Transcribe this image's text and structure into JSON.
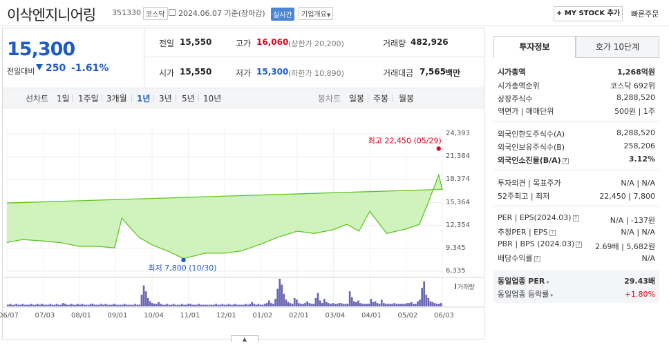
{
  "header": {
    "company": "이삭엔지니어링",
    "code": "351330",
    "market": "코스닥",
    "date_text": "2024.06.07 기준(장마감)",
    "realtime": "실시간",
    "company_info": "기업개요",
    "my_stock": "+ MY STOCK 추가",
    "quick_order": "빠른주문"
  },
  "quote": {
    "price": "15,300",
    "change_label": "전일대비",
    "change": "250",
    "change_pct": "-1.61%",
    "prev_close_label": "전일",
    "prev_close": "15,550",
    "high_label": "고가",
    "high": "16,060",
    "upper_limit": "(상한가 20,200)",
    "volume_label": "거래량",
    "volume": "482,926",
    "open_label": "시가",
    "open": "15,550",
    "low_label": "저가",
    "low": "15,300",
    "lower_limit": "(하한가 10,890)",
    "amount_label": "거래대금",
    "amount": "7,565",
    "amount_unit": "백만"
  },
  "period": {
    "line_label": "선차트",
    "tabs": [
      "1일",
      "1주일",
      "3개월",
      "1년",
      "3년",
      "5년",
      "10년"
    ],
    "selected": "1년",
    "candle_label": "봉차트",
    "candle_tabs": [
      "일봉",
      "주봉",
      "월봉"
    ]
  },
  "chart_data": {
    "type": "area",
    "title": "",
    "xlabel": "",
    "ylabel": "",
    "x_ticks": [
      "06/07",
      "07/03",
      "08/01",
      "09/01",
      "10/04",
      "11/01",
      "12/01",
      "01/02",
      "02/01",
      "03/04",
      "04/01",
      "05/02",
      "06/03"
    ],
    "y_ticks": [
      6335,
      9345,
      12354,
      15364,
      18374,
      21384,
      24393
    ],
    "ylim": [
      6335,
      24393
    ],
    "grid": true,
    "series": [
      {
        "dates": [
          "06/07",
          "06/20",
          "07/03",
          "07/17",
          "08/01",
          "08/16",
          "08/30",
          "09/06",
          "09/20",
          "10/04",
          "10/18",
          "10/30",
          "11/15",
          "12/01",
          "12/15",
          "01/02",
          "01/16",
          "02/01",
          "02/15",
          "03/04",
          "03/15",
          "03/25",
          "04/01",
          "04/15",
          "05/02",
          "05/13",
          "05/20",
          "05/29",
          "06/03",
          "06/07"
        ],
        "values": [
          10100,
          10500,
          10300,
          10100,
          9600,
          9600,
          9400,
          13300,
          10800,
          9800,
          8900,
          8000,
          8700,
          8700,
          9000,
          9900,
          10800,
          11600,
          11300,
          11800,
          12500,
          11600,
          14200,
          11300,
          11900,
          12500,
          15200,
          19000,
          17100,
          15300
        ]
      }
    ],
    "annotations": [
      {
        "label": "최고 22,450 (05/29)",
        "date": "05/29",
        "value": 22450
      },
      {
        "label": "최저 7,800 (10/30)",
        "date": "10/30",
        "value": 7800
      }
    ],
    "volume_label": "거래량",
    "volume": [
      2,
      3,
      2,
      2,
      3,
      2,
      2,
      3,
      2,
      2,
      2,
      3,
      2,
      2,
      3,
      2,
      3,
      2,
      2,
      2,
      3,
      2,
      2,
      3,
      2,
      2,
      4,
      3,
      2,
      2,
      3,
      2,
      2,
      3,
      2,
      3,
      2,
      2,
      2,
      3,
      3,
      2,
      2,
      2,
      3,
      2,
      3,
      2,
      2,
      2,
      3,
      2,
      2,
      2,
      2,
      3,
      2,
      2,
      2,
      2,
      3,
      2,
      2,
      14,
      25,
      18,
      10,
      6,
      4,
      3,
      3,
      5,
      3,
      2,
      2,
      3,
      2,
      2,
      3,
      2,
      2,
      2,
      3,
      2,
      2,
      3,
      3,
      2,
      2,
      2,
      3,
      2,
      2,
      2,
      2,
      2,
      2,
      2,
      3,
      2,
      2,
      3,
      2,
      2,
      3,
      2,
      2,
      3,
      2,
      2,
      2,
      2,
      3,
      2,
      3,
      5,
      3,
      2,
      3,
      2,
      2,
      3,
      4,
      7,
      4,
      3,
      9,
      21,
      33,
      26,
      15,
      8,
      5,
      4,
      3,
      10,
      8,
      4,
      3,
      3,
      4,
      6,
      4,
      3,
      3,
      10,
      16,
      7,
      4,
      9,
      5,
      4,
      3,
      4,
      3,
      3,
      4,
      4,
      3,
      3,
      3,
      18,
      11,
      6,
      5,
      7,
      4,
      3,
      3,
      3,
      3,
      9,
      5,
      6,
      4,
      3,
      8,
      4,
      3,
      3,
      3,
      3,
      4,
      3,
      3,
      3,
      3,
      3,
      4,
      4,
      5,
      3,
      3,
      6,
      8,
      22,
      30,
      14,
      10,
      6,
      5,
      4,
      3,
      3,
      4
    ]
  },
  "tabs": {
    "invest": "투자정보",
    "orderbook": "호가 10단계"
  },
  "invest_info": {
    "market_cap_label": "시가총액",
    "market_cap": "1,268억원",
    "rank_label": "시가총액순위",
    "rank": "코스닥 692위",
    "shares_label": "상장주식수",
    "shares": "8,288,520",
    "par_label": "액면가 | 매매단위",
    "par": "500원 | 1주",
    "foreign_limit_label": "외국인한도주식수(A)",
    "foreign_limit": "8,288,520",
    "foreign_hold_label": "외국인보유주식수(B)",
    "foreign_hold": "258,206",
    "foreign_ratio_label": "외국인소진율(B/A)",
    "foreign_ratio": "3.12%",
    "opinion_label": "투자의견 | 목표주가",
    "opinion": "N/A | N/A",
    "week52_label": "52주최고 | 최저",
    "week52": "22,450 | 7,800",
    "per_label": "PER | EPS(2024.03)",
    "per": "N/A | -137원",
    "est_per_label": "추정PER | EPS",
    "est_per": "N/A | N/A",
    "pbr_label": "PBR | BPS (2024.03)",
    "pbr": "2.69배 | 5,682원",
    "dividend_label": "배당수익률",
    "dividend": "N/A",
    "sector_per_label": "동일업종 PER",
    "sector_per": "29.43배",
    "sector_rate_label": "동일업종 등락률",
    "sector_rate": "+1.80%"
  },
  "colors": {
    "up": "#e0001e",
    "down": "#1f5bc6",
    "area": "#c8f0b0",
    "line": "#5cc51f"
  }
}
